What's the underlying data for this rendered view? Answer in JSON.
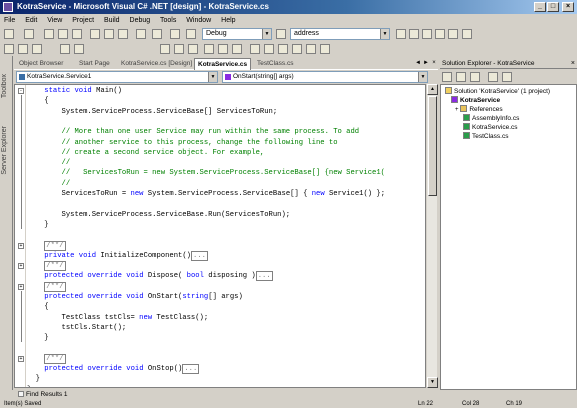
{
  "window": {
    "title": "KotraService - Microsoft Visual C# .NET [design] - KotraService.cs"
  },
  "menu": [
    "File",
    "Edit",
    "View",
    "Project",
    "Build",
    "Debug",
    "Tools",
    "Window",
    "Help"
  ],
  "toolbar": {
    "config_value": "Debug",
    "find_value": "address"
  },
  "left_strip": {
    "toolbox_label": "Toolbox",
    "server_explorer_label": "Server Explorer"
  },
  "doc_tabs": [
    {
      "label": "Object Browser"
    },
    {
      "label": "Start Page"
    },
    {
      "label": "KotraService.cs [Design]"
    },
    {
      "label": "KotraService.cs"
    },
    {
      "label": "TestClass.cs"
    }
  ],
  "navigation": {
    "type_combo": "KotraService.Service1",
    "member_combo": "OnStart(string[] args)"
  },
  "code_lines": [
    {
      "parts": [
        {
          "t": "    "
        },
        {
          "t": "static",
          "k": "kw"
        },
        {
          "t": " "
        },
        {
          "t": "void",
          "k": "kw"
        },
        {
          "t": " Main()"
        }
      ]
    },
    {
      "parts": [
        {
          "t": "    {"
        }
      ]
    },
    {
      "parts": [
        {
          "t": "        System.ServiceProcess.ServiceBase[] ServicesToRun;"
        }
      ]
    },
    {
      "parts": [
        {
          "t": ""
        }
      ]
    },
    {
      "parts": [
        {
          "t": "        // More than one user Service may run within the same process. To add",
          "k": "cm"
        }
      ]
    },
    {
      "parts": [
        {
          "t": "        // another service to this process, change the following line to",
          "k": "cm"
        }
      ]
    },
    {
      "parts": [
        {
          "t": "        // create a second service object. For example,",
          "k": "cm"
        }
      ]
    },
    {
      "parts": [
        {
          "t": "        //",
          "k": "cm"
        }
      ]
    },
    {
      "parts": [
        {
          "t": "        //   ServicesToRun = new System.ServiceProcess.ServiceBase[] {new Service1(",
          "k": "cm"
        }
      ]
    },
    {
      "parts": [
        {
          "t": "        //",
          "k": "cm"
        }
      ]
    },
    {
      "parts": [
        {
          "t": "        ServicesToRun = "
        },
        {
          "t": "new",
          "k": "kw"
        },
        {
          "t": " System.ServiceProcess.ServiceBase[] { "
        },
        {
          "t": "new",
          "k": "kw"
        },
        {
          "t": " Service1() };"
        }
      ]
    },
    {
      "parts": [
        {
          "t": ""
        }
      ]
    },
    {
      "parts": [
        {
          "t": "        System.ServiceProcess.ServiceBase.Run(ServicesToRun);"
        }
      ]
    },
    {
      "parts": [
        {
          "t": "    }"
        }
      ]
    },
    {
      "parts": [
        {
          "t": ""
        }
      ]
    },
    {
      "parts": [
        {
          "t": "    "
        },
        {
          "t": "/**/",
          "k": "collapsed"
        }
      ]
    },
    {
      "parts": [
        {
          "t": "    "
        },
        {
          "t": "private",
          "k": "kw"
        },
        {
          "t": " "
        },
        {
          "t": "void",
          "k": "kw"
        },
        {
          "t": " InitializeComponent()"
        },
        {
          "t": "...",
          "k": "collapsed"
        }
      ]
    },
    {
      "parts": [
        {
          "t": "    "
        },
        {
          "t": "/**/",
          "k": "collapsed"
        }
      ]
    },
    {
      "parts": [
        {
          "t": "    "
        },
        {
          "t": "protected",
          "k": "kw"
        },
        {
          "t": " "
        },
        {
          "t": "override",
          "k": "kw"
        },
        {
          "t": " "
        },
        {
          "t": "void",
          "k": "kw"
        },
        {
          "t": " Dispose( "
        },
        {
          "t": "bool",
          "k": "kw"
        },
        {
          "t": " disposing )"
        },
        {
          "t": "...",
          "k": "collapsed"
        }
      ]
    },
    {
      "parts": [
        {
          "t": "    "
        },
        {
          "t": "/**/",
          "k": "collapsed"
        }
      ]
    },
    {
      "parts": [
        {
          "t": "    "
        },
        {
          "t": "protected",
          "k": "kw"
        },
        {
          "t": " "
        },
        {
          "t": "override",
          "k": "kw"
        },
        {
          "t": " "
        },
        {
          "t": "void",
          "k": "kw"
        },
        {
          "t": " OnStart("
        },
        {
          "t": "string",
          "k": "kw"
        },
        {
          "t": "[] args)"
        }
      ]
    },
    {
      "parts": [
        {
          "t": "    {"
        }
      ]
    },
    {
      "parts": [
        {
          "t": "        TestClass tstCls= "
        },
        {
          "t": "new",
          "k": "kw"
        },
        {
          "t": " TestClass();"
        }
      ]
    },
    {
      "parts": [
        {
          "t": "        tstCls.Start();"
        }
      ]
    },
    {
      "parts": [
        {
          "t": "    }"
        }
      ]
    },
    {
      "parts": [
        {
          "t": ""
        }
      ]
    },
    {
      "parts": [
        {
          "t": "    "
        },
        {
          "t": "/**/",
          "k": "collapsed"
        }
      ]
    },
    {
      "parts": [
        {
          "t": "    "
        },
        {
          "t": "protected",
          "k": "kw"
        },
        {
          "t": " "
        },
        {
          "t": "override",
          "k": "kw"
        },
        {
          "t": " "
        },
        {
          "t": "void",
          "k": "kw"
        },
        {
          "t": " OnStop()"
        },
        {
          "t": "...",
          "k": "collapsed"
        }
      ]
    },
    {
      "parts": [
        {
          "t": "  }"
        }
      ]
    },
    {
      "parts": [
        {
          "t": "}"
        }
      ]
    }
  ],
  "solution_explorer": {
    "title": "Solution Explorer - KotraService",
    "items": [
      {
        "label": "Solution 'KotraService' (1 project)",
        "icon": "solution"
      },
      {
        "label": "KotraService",
        "icon": "project"
      },
      {
        "label": "References",
        "icon": "folder"
      },
      {
        "label": "AssemblyInfo.cs",
        "icon": "cs"
      },
      {
        "label": "KotraService.cs",
        "icon": "cs"
      },
      {
        "label": "TestClass.cs",
        "icon": "cs"
      }
    ]
  },
  "output_tab": "Find Results 1",
  "status": {
    "message": "Item(s) Saved",
    "line": "Ln 22",
    "col": "Col 28",
    "ch": "Ch 19"
  },
  "colors": {
    "keyword": "#0000FF",
    "comment": "#008000",
    "titlebar": "#0A246A"
  }
}
